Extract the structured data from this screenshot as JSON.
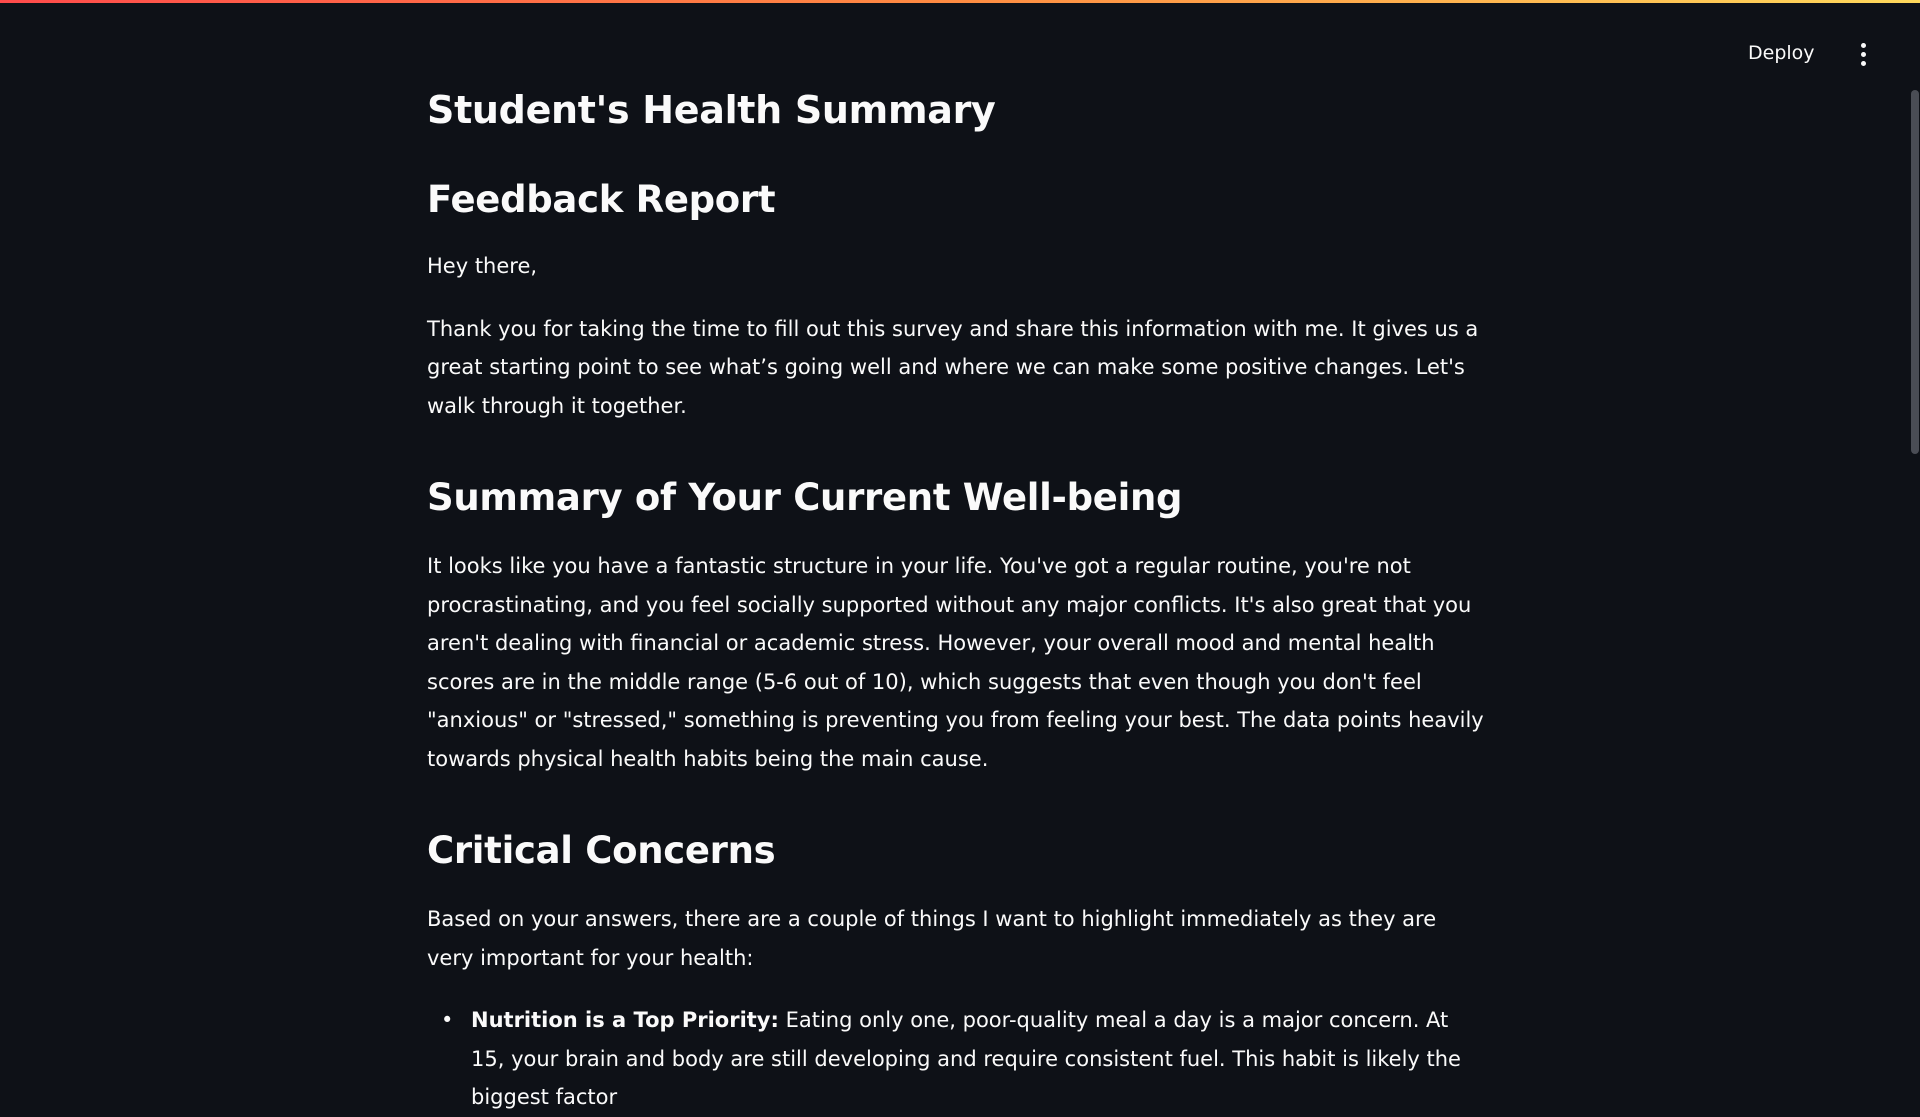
{
  "header": {
    "deploy_label": "Deploy",
    "menu_icon": "vertical-dots-icon"
  },
  "colors": {
    "background": "#0e1117",
    "text": "#fafafa",
    "stripe_start": "#ff4b4b",
    "stripe_end": "#ffd95c"
  },
  "main": {
    "app_title": "Student's Health Summary",
    "report_heading": "Feedback Report",
    "greeting": "Hey there,",
    "intro": "Thank you for taking the time to fill out this survey and share this information with me. It gives us a great starting point to see what’s going well and where we can make some positive changes. Let's walk through it together.",
    "summary_heading": "Summary of Your Current Well-being",
    "summary_text": "It looks like you have a fantastic structure in your life. You've got a regular routine, you're not procrastinating, and you feel socially supported without any major conflicts. It's also great that you aren't dealing with financial or academic stress. However, your overall mood and mental health scores are in the middle range (5-6 out of 10), which suggests that even though you don't feel \"anxious\" or \"stressed,\" something is preventing you from feeling your best. The data points heavily towards physical health habits being the main cause.",
    "concerns_heading": "Critical Concerns",
    "concerns_intro": "Based on your answers, there are a couple of things I want to highlight immediately as they are very important for your health:",
    "concerns": [
      {
        "bullet": "•",
        "title": "Nutrition is a Top Priority:",
        "text": " Eating only one, poor-quality meal a day is a major concern. At 15, your brain and body are still developing and require consistent fuel. This habit is likely the biggest factor"
      }
    ]
  }
}
